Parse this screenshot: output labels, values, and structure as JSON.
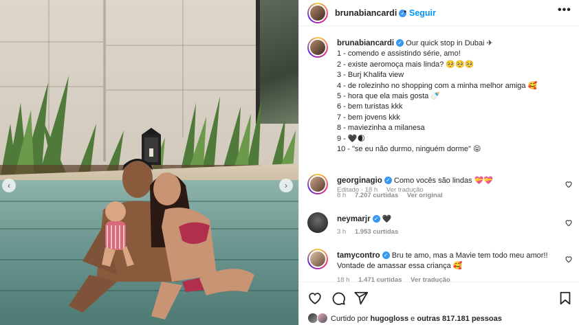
{
  "post": {
    "author": "brunabiancardi",
    "follow_label": "Seguir",
    "separator": "•",
    "more_label": "•••",
    "nav_prev": "‹",
    "nav_next": "›"
  },
  "caption": {
    "username": "brunabiancardi",
    "lines": [
      "Our quick stop in Dubai ✈",
      "1 - comendo e assistindo série, amo!",
      "2 - existe aeromoça mais linda? 🥺🥺🥺",
      "3 - Burj Khalifa view",
      "4 - de rolezinho no shopping com a minha melhor amiga 🥰",
      "5 - hora que ela mais gosta 🍼",
      "6 - bem turistas kkk",
      "7 - bem jovens kkk",
      "8 - maviezinha a milanesa",
      "9 - 🖤🌒",
      "10 - \"se eu não durmo, ninguém dorme\" 😝"
    ],
    "edited": "Editado · 18 h",
    "translate": "Ver tradução"
  },
  "comments": [
    {
      "username": "georginagio",
      "text": "Como vocês são lindas 💝💝",
      "time": "8 h",
      "likes": "7.207 curtidas",
      "action": "Ver original"
    },
    {
      "username": "neymarjr",
      "text": "🖤",
      "time": "3 h",
      "likes": "1.953 curtidas",
      "action": ""
    },
    {
      "username": "tamycontro",
      "text": "Bru te amo, mas a Mavie tem todo meu amor!!",
      "text2": "Vontade de amassar essa criança 🥰",
      "time": "18 h",
      "likes": "1.471 curtidas",
      "action": "Ver tradução"
    }
  ],
  "likes_bar": {
    "prefix": "Curtido por",
    "user": "hugogloss",
    "middle": "e",
    "others": "outras 817.181 pessoas"
  },
  "icons": [
    "verified-badge",
    "heart-icon",
    "comment-icon",
    "share-icon",
    "bookmark-icon",
    "more-icon",
    "chevron-left-icon",
    "chevron-right-icon"
  ],
  "colors": {
    "accent": "#0095f6",
    "verified": "#3897f0",
    "muted": "#8e8e8e"
  }
}
